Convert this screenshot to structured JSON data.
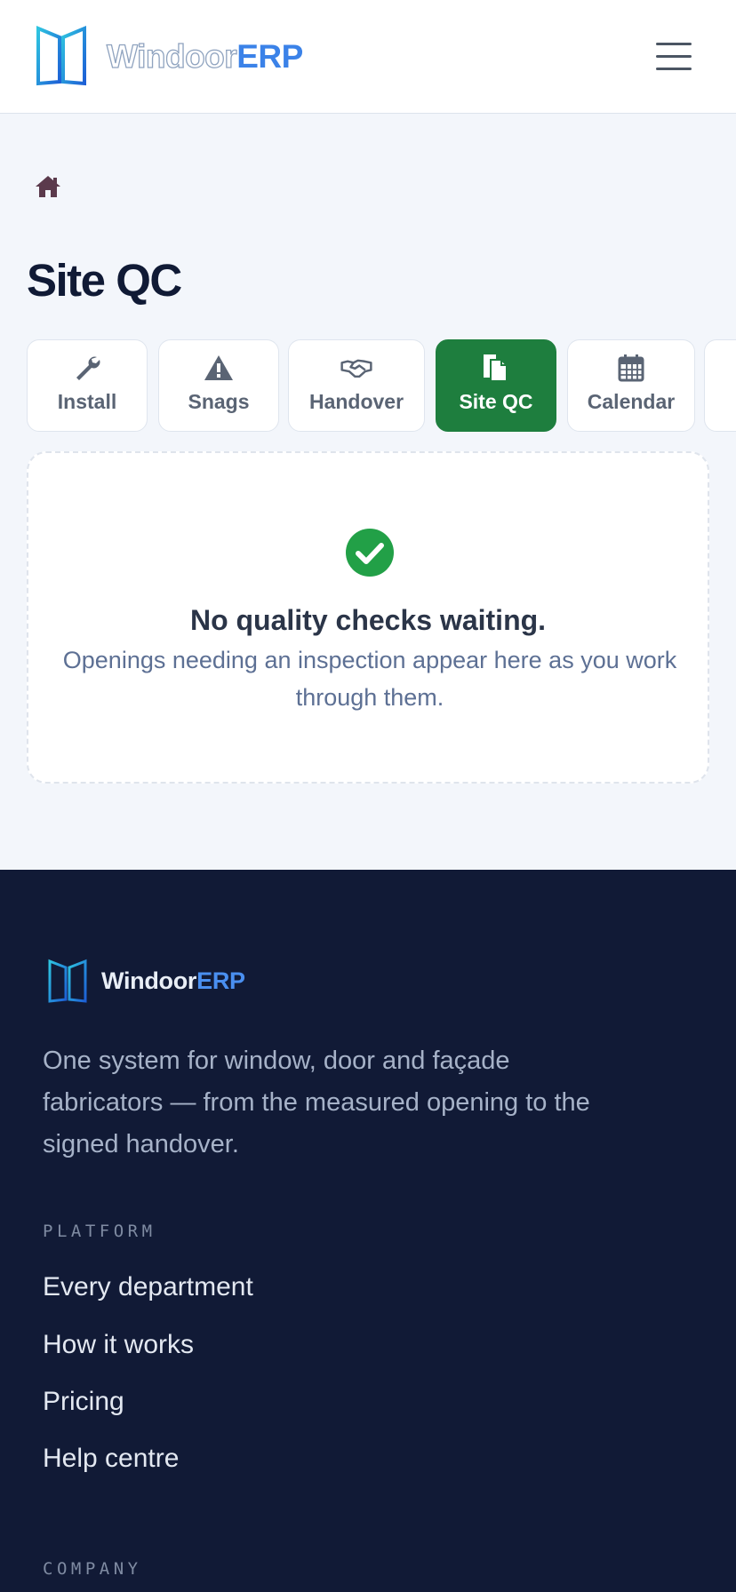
{
  "header": {
    "logo_part1": "Windoor",
    "logo_part2": "ERP",
    "menu_icon": "hamburger-menu-icon"
  },
  "breadcrumb": {
    "home_icon": "home-icon"
  },
  "page": {
    "title": "Site QC"
  },
  "tabs": [
    {
      "label": "Install",
      "icon": "wrench-icon",
      "active": false
    },
    {
      "label": "Snags",
      "icon": "warning-triangle-icon",
      "active": false
    },
    {
      "label": "Handover",
      "icon": "handshake-icon",
      "active": false
    },
    {
      "label": "Site QC",
      "icon": "document-copy-icon",
      "active": true
    },
    {
      "label": "Calendar",
      "icon": "calendar-icon",
      "active": false
    }
  ],
  "empty_state": {
    "icon": "check-circle-icon",
    "title": "No quality checks waiting.",
    "text": "Openings needing an inspection appear here as you work through them."
  },
  "footer": {
    "logo_part1": "Windoor",
    "logo_part2": "ERP",
    "tagline": "One system for window, door and façade fabricators — from the measured opening to the signed handover.",
    "platform_heading": "PLATFORM",
    "platform_links": [
      "Every department",
      "How it works",
      "Pricing",
      "Help centre"
    ],
    "company_heading": "COMPANY"
  },
  "colors": {
    "accent_green": "#1e7e3e",
    "brand_blue": "#3b82e8",
    "footer_bg": "#111a36",
    "page_bg": "#f3f6fb"
  }
}
